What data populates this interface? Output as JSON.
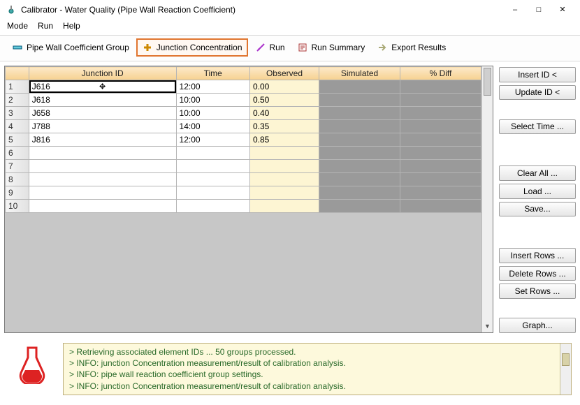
{
  "window": {
    "title": "Calibrator - Water Quality (Pipe Wall Reaction Coefficient)"
  },
  "menu": {
    "mode": "Mode",
    "run": "Run",
    "help": "Help"
  },
  "toolbar": {
    "pipe_group": "Pipe Wall Coefficient Group",
    "junction_conc": "Junction Concentration",
    "run": "Run",
    "run_summary": "Run Summary",
    "export": "Export Results"
  },
  "grid": {
    "headers": {
      "id": "Junction ID",
      "time": "Time",
      "obs": "Observed",
      "sim": "Simulated",
      "pdiff": "% Diff"
    },
    "rows": [
      {
        "n": "1",
        "id": "J616",
        "time": "12:00",
        "obs": "0.00"
      },
      {
        "n": "2",
        "id": "J618",
        "time": "10:00",
        "obs": "0.50"
      },
      {
        "n": "3",
        "id": "J658",
        "time": "10:00",
        "obs": "0.40"
      },
      {
        "n": "4",
        "id": "J788",
        "time": "14:00",
        "obs": "0.35"
      },
      {
        "n": "5",
        "id": "J816",
        "time": "12:00",
        "obs": "0.85"
      },
      {
        "n": "6",
        "id": "",
        "time": "",
        "obs": ""
      },
      {
        "n": "7",
        "id": "",
        "time": "",
        "obs": ""
      },
      {
        "n": "8",
        "id": "",
        "time": "",
        "obs": ""
      },
      {
        "n": "9",
        "id": "",
        "time": "",
        "obs": ""
      },
      {
        "n": "10",
        "id": "",
        "time": "",
        "obs": ""
      }
    ]
  },
  "buttons": {
    "insert_id": "Insert ID <",
    "update_id": "Update ID <",
    "select_time": "Select Time ...",
    "clear_all": "Clear All ...",
    "load": "Load ...",
    "save": "Save...",
    "insert_rows": "Insert Rows ...",
    "delete_rows": "Delete Rows ...",
    "set_rows": "Set Rows ...",
    "graph": "Graph..."
  },
  "log": {
    "l1": "> Retrieving associated element IDs ... 50 groups processed.",
    "l2": "> INFO: junction Concentration measurement/result of calibration analysis.",
    "l3": "> INFO: pipe wall reaction coefficient group settings.",
    "l4": "> INFO: junction Concentration measurement/result of calibration analysis."
  }
}
